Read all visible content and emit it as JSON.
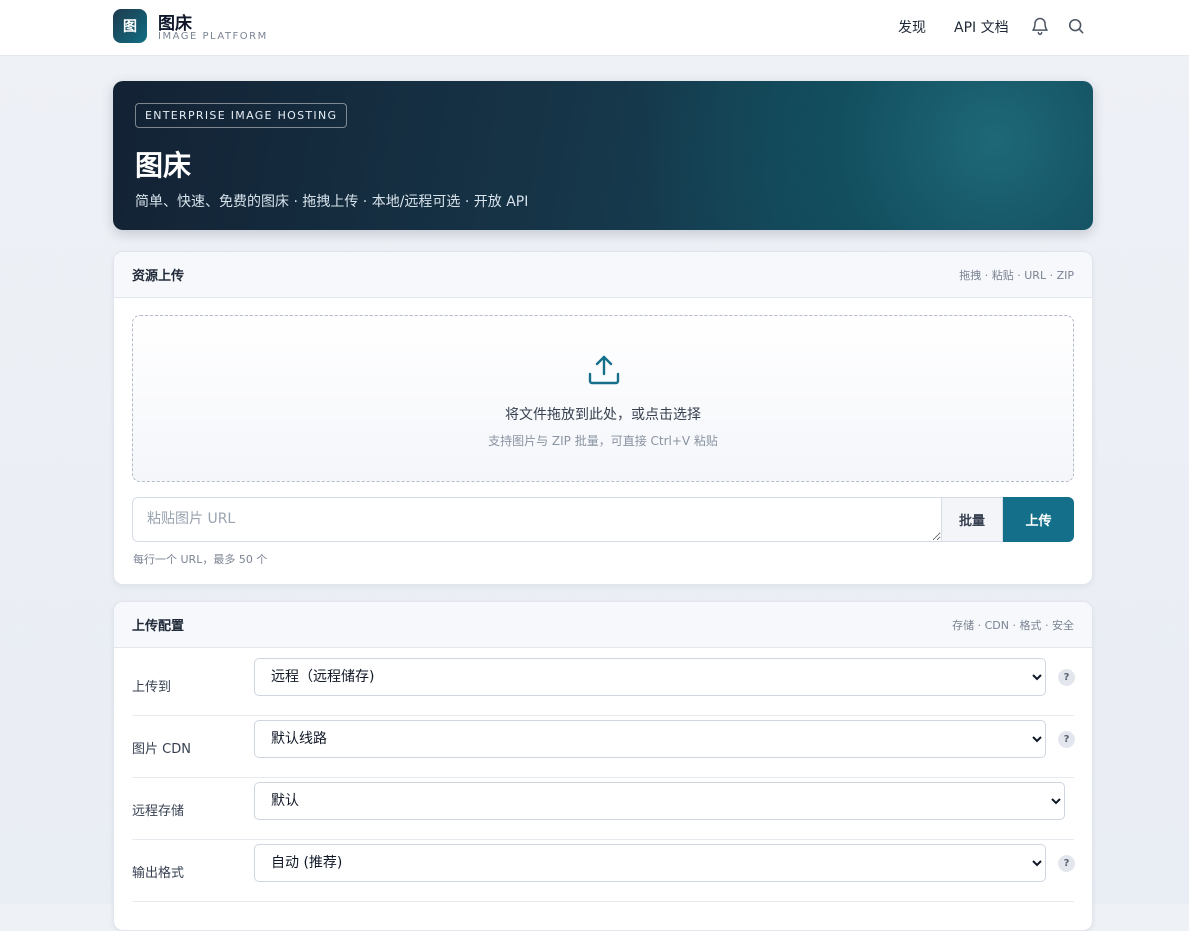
{
  "brand": {
    "logo_char": "图",
    "title": "图床",
    "subtitle": "IMAGE PLATFORM"
  },
  "nav": {
    "discover": "发现",
    "api_docs": "API 文档"
  },
  "hero": {
    "tag": "ENTERPRISE IMAGE HOSTING",
    "title": "图床",
    "subtitle": "简单、快速、免费的图床 · 拖拽上传 · 本地/远程可选 · 开放 API"
  },
  "upload": {
    "title": "资源上传",
    "meta": "拖拽 · 粘贴 · URL · ZIP",
    "drop_main": "将文件拖放到此处，或点击选择",
    "drop_hint": "支持图片与 ZIP 批量，可直接 Ctrl+V 粘贴",
    "url_placeholder": "粘贴图片 URL",
    "batch_label": "批量",
    "upload_label": "上传",
    "url_hint": "每行一个 URL，最多 50 个"
  },
  "config": {
    "title": "上传配置",
    "meta": "存储 · CDN · 格式 · 安全",
    "rows": [
      {
        "label": "上传到",
        "value": "远程（远程储存)",
        "help": "?"
      },
      {
        "label": "图片 CDN",
        "value": "默认线路",
        "help": "?"
      },
      {
        "label": "远程存储",
        "value": "默认"
      },
      {
        "label": "输出格式",
        "value": "自动 (推荐)",
        "help": "?"
      }
    ]
  },
  "colors": {
    "accent": "#14708a",
    "hero_dark": "#132234",
    "hero_teal": "#135266"
  }
}
